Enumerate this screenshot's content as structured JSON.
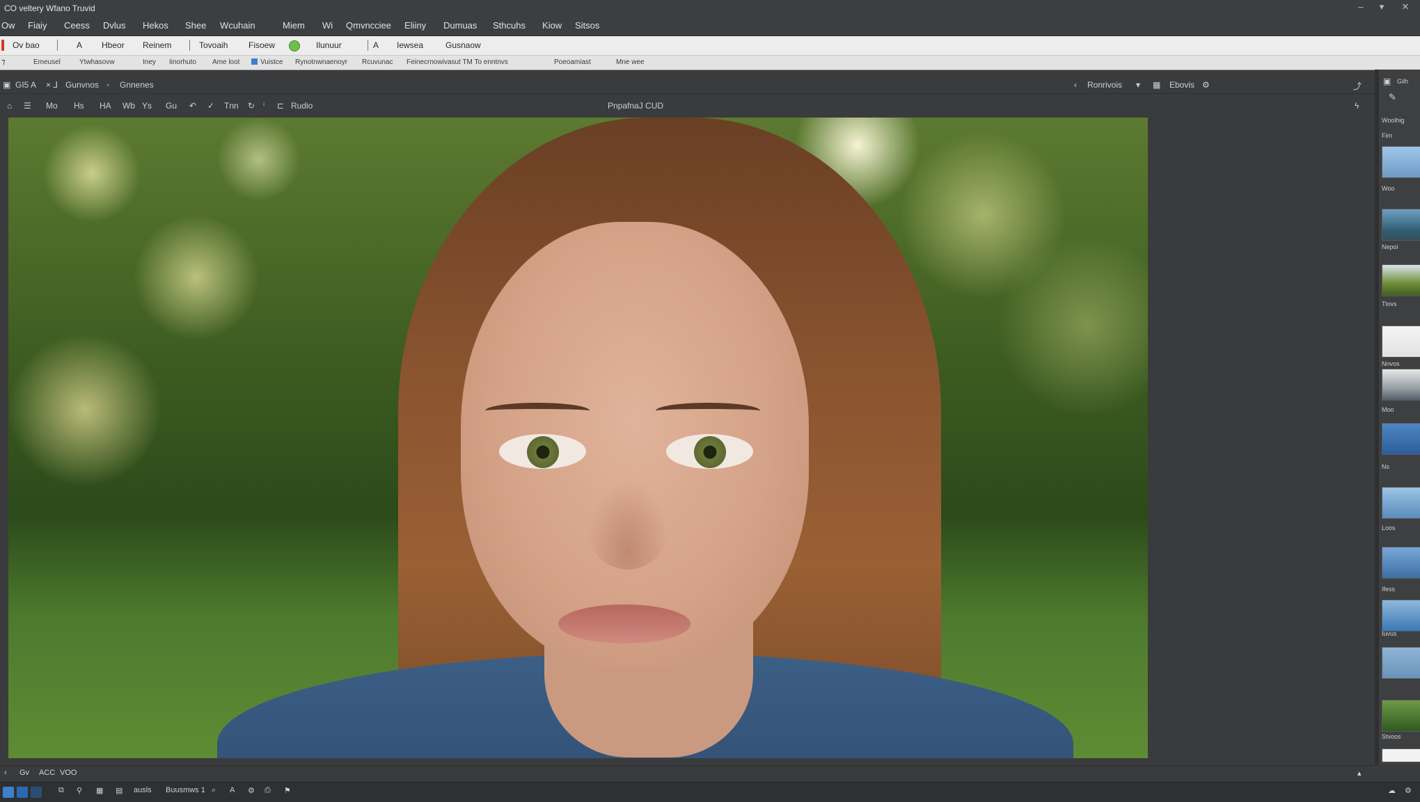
{
  "window": {
    "title": "CO veltery Wfano Truvid",
    "controls": [
      "–",
      "▾",
      "✕"
    ]
  },
  "menu": [
    "Ow",
    "Fiaiy",
    "Ceess",
    "Dvlus",
    "Hekos",
    "Shee",
    "Wcuhain",
    "Miem",
    "Wi",
    "Qmvncciee",
    "Eliiny",
    "Dumuas",
    "Sthcuhs",
    "Kiow",
    "Sitsos"
  ],
  "toolbar1": {
    "items": [
      "Ov bao",
      "A",
      "Hbeor",
      "Reinem",
      "Tovoaih",
      "Fisoew",
      "Ilunuur",
      "A",
      "Iewsea",
      "Gusnaow"
    ]
  },
  "toolbar2": {
    "items": [
      "Emeusel",
      "Ytwhasovw",
      "Iney",
      "Iinorhuto",
      "Ame loot",
      "Vuistce",
      "Rynotnwnaenoyr",
      "Rcuvunac",
      "Feinecrnowivasut TM To enntnvs",
      "Poeoamiast",
      "Mne wee"
    ]
  },
  "docbar": {
    "tab1": "GI5 A",
    "tab2": "Gunvnos",
    "tab3": "Gnnenes",
    "right1": "Ronrivois",
    "right2": "Ebovis"
  },
  "optbar": {
    "items": [
      "Mo",
      "Hs",
      "HA",
      "Wb",
      "Ys",
      "Gu",
      "Tnn",
      "Rudio"
    ],
    "doc_title": "PnpafnaJ CUD"
  },
  "right_panel": {
    "tab_label": "Gilh",
    "labels": [
      "Woolhig",
      "Fim",
      "Woo",
      "Nepoi",
      "Tlovs",
      "Nnvos",
      "Moo",
      "Ns",
      "Loos",
      "Ifess",
      "Iuvus",
      "Stvoos"
    ]
  },
  "statusbar": {
    "items": [
      "Gv",
      "ACC",
      "VOO"
    ]
  },
  "taskbar": {
    "items": [
      "ausls",
      "Buusmws 1"
    ]
  },
  "colors": {
    "chrome": "#3a3b3d",
    "toolbar_light": "#ededed",
    "accent": "#3f7fd0"
  },
  "icons": [
    "menu-icon",
    "zoom-icon",
    "hand-icon",
    "brush-icon",
    "layers-icon",
    "settings-icon"
  ]
}
